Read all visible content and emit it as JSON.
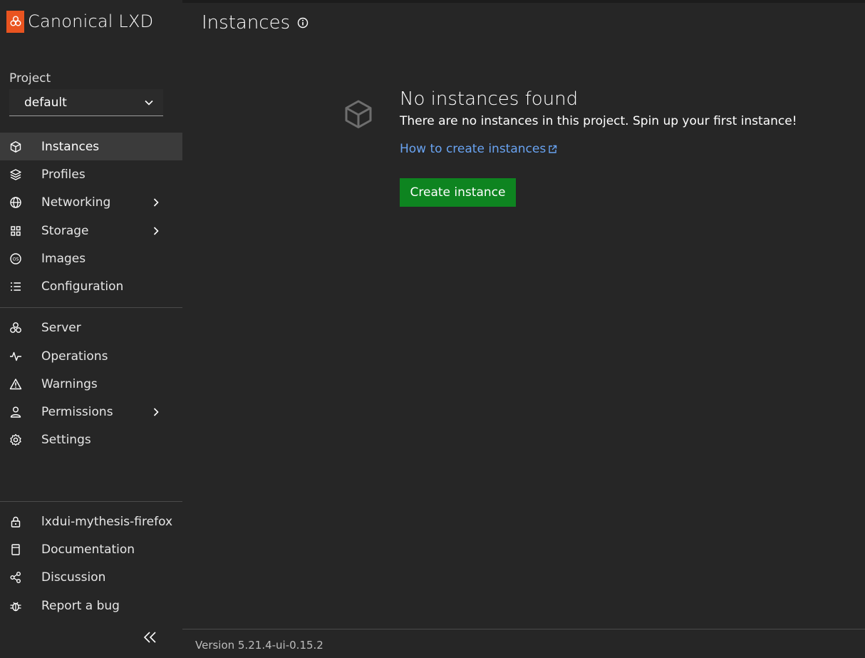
{
  "brand": {
    "name": "Canonical LXD",
    "accent_color": "#e95420"
  },
  "project": {
    "label": "Project",
    "selected": "default"
  },
  "nav_main": [
    {
      "label": "Instances",
      "icon": "instances-icon",
      "active": true,
      "has_submenu": false
    },
    {
      "label": "Profiles",
      "icon": "profiles-icon",
      "active": false,
      "has_submenu": false
    },
    {
      "label": "Networking",
      "icon": "networking-icon",
      "active": false,
      "has_submenu": true
    },
    {
      "label": "Storage",
      "icon": "storage-icon",
      "active": false,
      "has_submenu": true
    },
    {
      "label": "Images",
      "icon": "images-icon",
      "active": false,
      "has_submenu": false
    },
    {
      "label": "Configuration",
      "icon": "configuration-icon",
      "active": false,
      "has_submenu": false
    }
  ],
  "nav_admin": [
    {
      "label": "Server",
      "icon": "server-icon",
      "has_submenu": false
    },
    {
      "label": "Operations",
      "icon": "operations-icon",
      "has_submenu": false
    },
    {
      "label": "Warnings",
      "icon": "warning-icon",
      "has_submenu": false
    },
    {
      "label": "Permissions",
      "icon": "permissions-icon",
      "has_submenu": true
    },
    {
      "label": "Settings",
      "icon": "settings-icon",
      "has_submenu": false
    }
  ],
  "nav_footer": [
    {
      "label": "lxdui-mythesis-firefox",
      "icon": "lock-icon"
    },
    {
      "label": "Documentation",
      "icon": "documentation-icon"
    },
    {
      "label": "Discussion",
      "icon": "share-icon"
    },
    {
      "label": "Report a bug",
      "icon": "bug-icon"
    }
  ],
  "page": {
    "title": "Instances"
  },
  "empty_state": {
    "title": "No instances found",
    "text": "There are no instances in this project. Spin up your first instance!",
    "link": "How to create instances",
    "button": "Create instance",
    "button_color": "#0e8420"
  },
  "version": "Version 5.21.4-ui-0.15.2"
}
